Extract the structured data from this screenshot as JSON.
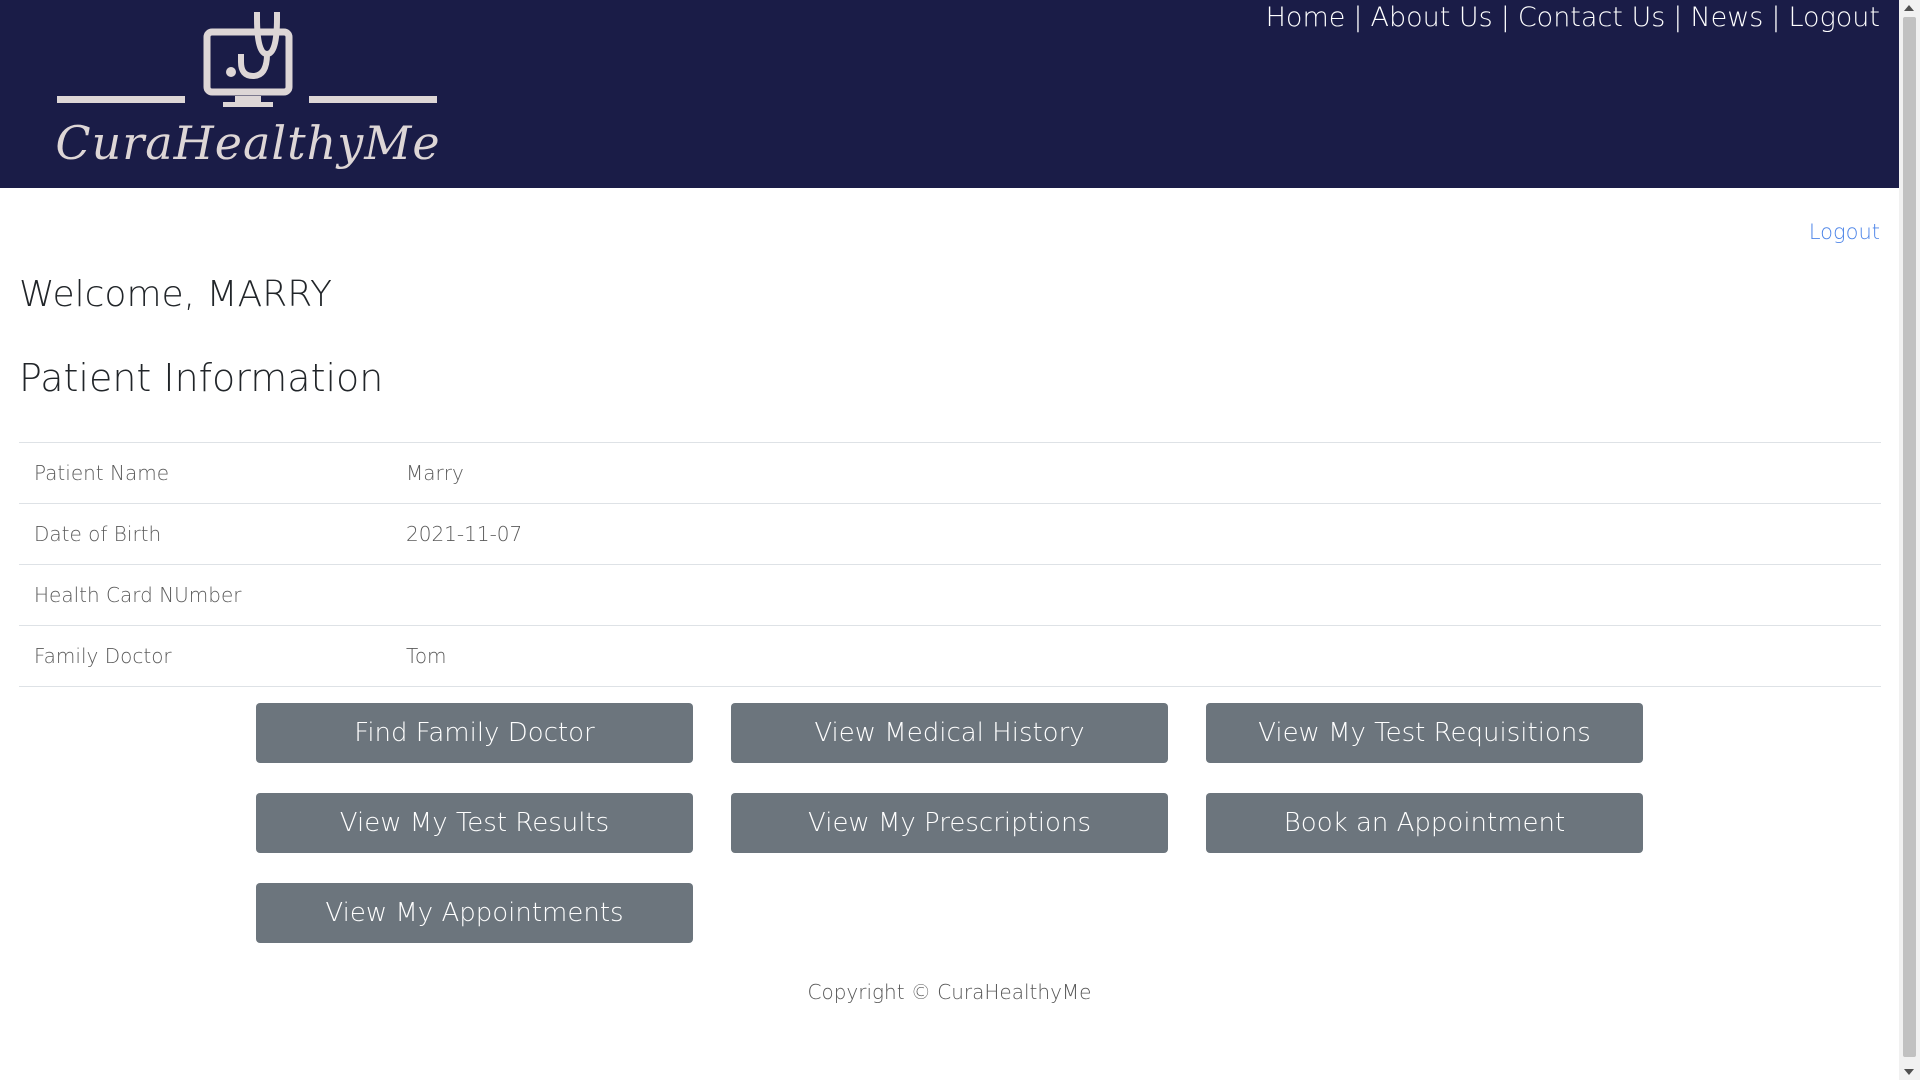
{
  "header": {
    "logo_text": "CuraHealthyMe",
    "nav": [
      {
        "label": "Home"
      },
      {
        "label": "About Us"
      },
      {
        "label": "Contact Us"
      },
      {
        "label": "News"
      },
      {
        "label": "Logout"
      }
    ],
    "separator": "|"
  },
  "main": {
    "logout_link": "Logout",
    "welcome": "Welcome, MARRY",
    "section_title": "Patient Information",
    "patient_info": [
      {
        "label": "Patient Name",
        "value": "Marry"
      },
      {
        "label": "Date of Birth",
        "value": "2021-11-07"
      },
      {
        "label": "Health Card NUmber",
        "value": ""
      },
      {
        "label": "Family Doctor",
        "value": "Tom"
      }
    ],
    "actions": [
      {
        "label": "Find Family Doctor"
      },
      {
        "label": "View Medical History"
      },
      {
        "label": "View My Test Requisitions"
      },
      {
        "label": "View My Test Results"
      },
      {
        "label": "View My Prescriptions"
      },
      {
        "label": "Book an Appointment"
      },
      {
        "label": "View My Appointments"
      }
    ]
  },
  "footer": {
    "copyright": "Copyright © CuraHealthyMe"
  },
  "colors": {
    "header_bg": "#1a1c47",
    "button_bg": "#6c757d",
    "link": "#4f86e8",
    "logo_color": "#ddd6d6"
  }
}
